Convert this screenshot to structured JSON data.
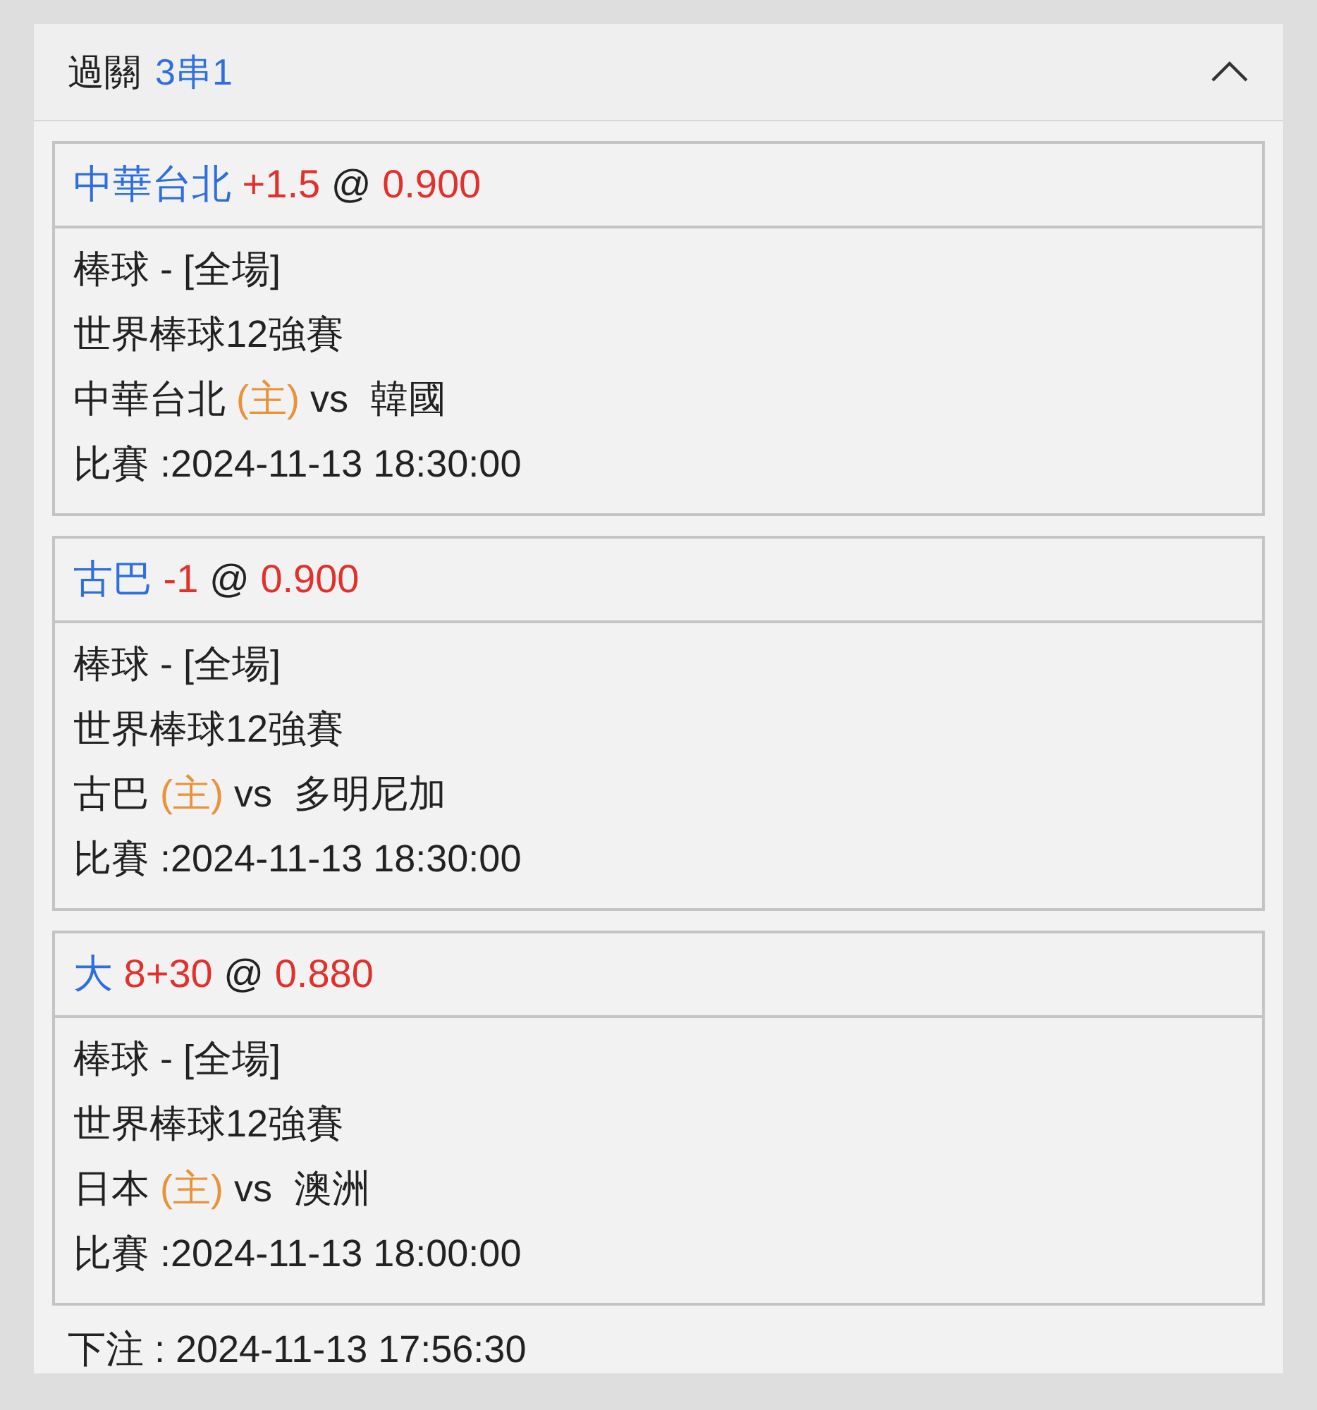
{
  "header": {
    "title": "過關",
    "combo": "3串1",
    "expanded": true
  },
  "bets": [
    {
      "selection": "中華台北",
      "line": "+1.5",
      "at": "@",
      "odds": "0.900",
      "sport": "棒球 - [全場]",
      "league": "世界棒球12強賽",
      "home": "中華台北",
      "home_tag": "(主)",
      "vs": "vs",
      "away": "韓國",
      "match_time": "比賽 :2024-11-13 18:30:00"
    },
    {
      "selection": "古巴",
      "line": "-1",
      "at": "@",
      "odds": "0.900",
      "sport": "棒球 - [全場]",
      "league": "世界棒球12強賽",
      "home": "古巴",
      "home_tag": "(主)",
      "vs": "vs",
      "away": "多明尼加",
      "match_time": "比賽 :2024-11-13 18:30:00"
    },
    {
      "selection": "大",
      "line": "8+30",
      "at": "@",
      "odds": "0.880",
      "sport": "棒球 - [全場]",
      "league": "世界棒球12強賽",
      "home": "日本",
      "home_tag": "(主)",
      "vs": "vs",
      "away": "澳洲",
      "match_time": "比賽 :2024-11-13 18:00:00"
    }
  ],
  "bet_time": "下注 : 2024-11-13 17:56:30"
}
